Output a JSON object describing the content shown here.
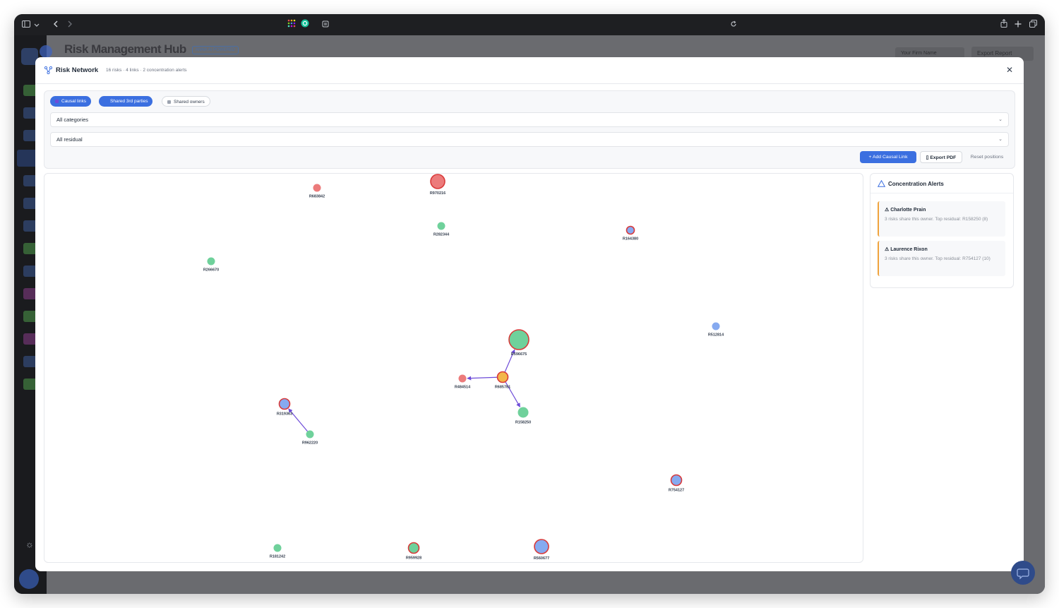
{
  "browser": {
    "icons": [
      "sidebar-toggle-icon",
      "chevron-down-icon",
      "back-icon",
      "forward-icon",
      "apps-grid-icon",
      "extension-icon",
      "page-icon",
      "reload-icon",
      "share-icon",
      "new-tab-icon",
      "tabs-icon"
    ]
  },
  "app": {
    "title": "Risk Management Hub",
    "badge": "ANNA AI POWERED",
    "firm_select": "Your Firm Name",
    "export_report": "Export Report"
  },
  "modal": {
    "title": "Risk Network",
    "subtitle": "16 risks · 4 links · 2 concentration alerts",
    "chips": [
      {
        "label": "Causal links",
        "active": true,
        "swatch": "#6d4bd8"
      },
      {
        "label": "Shared 3rd parties",
        "active": true,
        "swatch": "#3b6fe0"
      },
      {
        "label": "Shared owners",
        "active": false,
        "swatch": "#9ca3af"
      }
    ],
    "category_filter": "All categories",
    "residual_filter": "All residual",
    "add_link": "Add Causal Link",
    "export_pdf": "Export PDF",
    "reset": "Reset positions"
  },
  "colors": {
    "green": "#6fd19b",
    "red": "#ec7b7b",
    "blue": "#86aaf0",
    "orange": "#f3b64a",
    "ring": "#d93a3a",
    "edge": "#6d4bd8"
  },
  "nodes": [
    {
      "id": "R683842",
      "fill": "red",
      "ring": false,
      "size": "s"
    },
    {
      "id": "R970216",
      "fill": "red",
      "ring": true,
      "size": "l"
    },
    {
      "id": "R282344",
      "fill": "green",
      "ring": false,
      "size": "s"
    },
    {
      "id": "R164380",
      "fill": "blue",
      "ring": true,
      "size": "s"
    },
    {
      "id": "R266670",
      "fill": "green",
      "ring": false,
      "size": "s"
    },
    {
      "id": "R512814",
      "fill": "blue",
      "ring": false,
      "size": "s"
    },
    {
      "id": "R596675",
      "fill": "green",
      "ring": true,
      "size": "xl"
    },
    {
      "id": "R685781",
      "fill": "orange",
      "ring": true,
      "size": "m"
    },
    {
      "id": "R484514",
      "fill": "red",
      "ring": false,
      "size": "s"
    },
    {
      "id": "R158250",
      "fill": "green",
      "ring": false,
      "size": "m"
    },
    {
      "id": "R319363",
      "fill": "blue",
      "ring": true,
      "size": "m"
    },
    {
      "id": "R962220",
      "fill": "green",
      "ring": false,
      "size": "s"
    },
    {
      "id": "R754127",
      "fill": "blue",
      "ring": true,
      "size": "m"
    },
    {
      "id": "R181242",
      "fill": "green",
      "ring": false,
      "size": "s"
    },
    {
      "id": "R959928",
      "fill": "green",
      "ring": true,
      "size": "m"
    },
    {
      "id": "R560677",
      "fill": "blue",
      "ring": true,
      "size": "l"
    }
  ],
  "links": [
    {
      "from": "R685781",
      "to": "R596675"
    },
    {
      "from": "R685781",
      "to": "R484514"
    },
    {
      "from": "R685781",
      "to": "R158250"
    },
    {
      "from": "R962220",
      "to": "R319363"
    }
  ],
  "alerts": {
    "title": "Concentration Alerts",
    "items": [
      {
        "name": "⚠ Charlotte Prain",
        "text": "3 risks share this owner. Top residual: R158250 (8)"
      },
      {
        "name": "⚠ Laurence Rixon",
        "text": "3 risks share this owner. Top residual: R754127 (10)"
      }
    ]
  }
}
